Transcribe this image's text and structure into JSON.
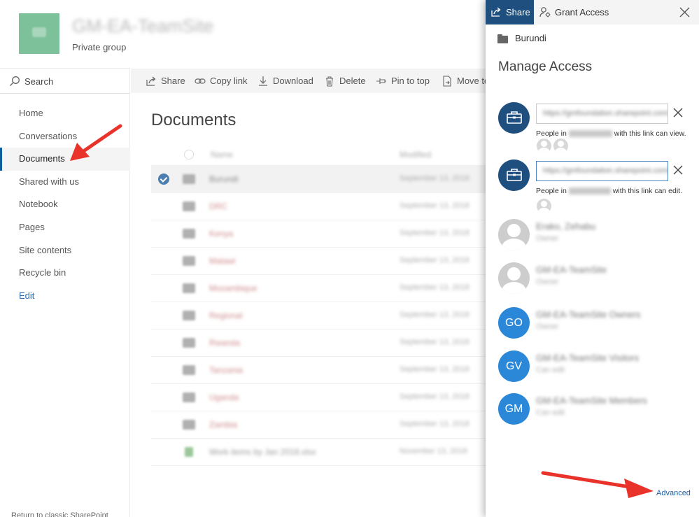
{
  "site": {
    "title": "GM-EA-TeamSite",
    "subtitle": "Private group"
  },
  "left_nav": {
    "search_label": "Search",
    "items": [
      {
        "label": "Home"
      },
      {
        "label": "Conversations"
      },
      {
        "label": "Documents",
        "active": true
      },
      {
        "label": "Shared with us"
      },
      {
        "label": "Notebook"
      },
      {
        "label": "Pages"
      },
      {
        "label": "Site contents"
      },
      {
        "label": "Recycle bin"
      },
      {
        "label": "Edit"
      }
    ],
    "return_classic": "Return to classic SharePoint"
  },
  "command_bar": {
    "share": "Share",
    "copy_link": "Copy link",
    "download": "Download",
    "delete": "Delete",
    "pin_to_top": "Pin to top",
    "move_to": "Move to"
  },
  "documents": {
    "title": "Documents",
    "columns": {
      "name": "Name",
      "modified": "Modified"
    },
    "rows": [
      {
        "name": "Burundi",
        "modified": "September 13, 2018",
        "selected": true,
        "type": "folder"
      },
      {
        "name": "DRC",
        "modified": "September 13, 2018",
        "type": "folder"
      },
      {
        "name": "Kenya",
        "modified": "September 13, 2018",
        "type": "folder"
      },
      {
        "name": "Malawi",
        "modified": "September 13, 2018",
        "type": "folder"
      },
      {
        "name": "Mozambique",
        "modified": "September 13, 2018",
        "type": "folder"
      },
      {
        "name": "Regional",
        "modified": "September 13, 2018",
        "type": "folder"
      },
      {
        "name": "Rwanda",
        "modified": "September 13, 2018",
        "type": "folder"
      },
      {
        "name": "Tanzania",
        "modified": "September 13, 2018",
        "type": "folder"
      },
      {
        "name": "Uganda",
        "modified": "September 13, 2018",
        "type": "folder"
      },
      {
        "name": "Zambia",
        "modified": "September 13, 2018",
        "type": "folder"
      },
      {
        "name": "Work items by Jan 2018.xlsx",
        "modified": "November 13, 2018",
        "type": "file"
      }
    ]
  },
  "share_panel": {
    "tab_share": "Share",
    "tab_grant": "Grant Access",
    "folder_name": "Burundi",
    "title": "Manage Access",
    "links": [
      {
        "url": "https://gmfoundation.sharepoint.com/...",
        "desc_prefix": "People in",
        "org": "GM Foundation",
        "desc_suffix": "with this link can view."
      },
      {
        "url": "https://gmfoundation.sharepoint.com/...",
        "desc_prefix": "People in",
        "org": "GM Foundation",
        "desc_suffix": "with this link can edit."
      }
    ],
    "members": [
      {
        "name": "Erako, Zehabu",
        "role": "Owner",
        "initials": ""
      },
      {
        "name": "GM-EA-TeamSite",
        "role": "Owner",
        "initials": ""
      },
      {
        "name": "GM-EA-TeamSite Owners",
        "role": "Owner",
        "initials": "GO"
      },
      {
        "name": "GM-EA-TeamSite Visitors",
        "role": "Can edit",
        "initials": "GV"
      },
      {
        "name": "GM-EA-TeamSite Members",
        "role": "Can edit",
        "initials": "GM"
      }
    ],
    "advanced": "Advanced"
  },
  "colors": {
    "accent": "#1f4f7f",
    "member_blue": "#2b88d8",
    "annotation_red": "#e8322a",
    "logo_green": "#7cc19a"
  }
}
